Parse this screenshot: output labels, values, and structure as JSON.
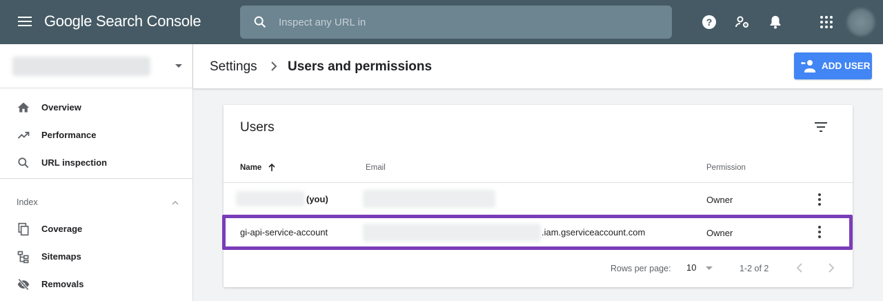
{
  "app": {
    "logo_text": "Google Search Console"
  },
  "search": {
    "placeholder": "Inspect any URL in"
  },
  "top_icons": [
    "help-icon",
    "manage-accounts-icon",
    "notifications-icon",
    "apps-grid-icon"
  ],
  "sidebar": {
    "items": [
      {
        "label": "Overview",
        "icon": "home-icon"
      },
      {
        "label": "Performance",
        "icon": "trending-up-icon"
      },
      {
        "label": "URL inspection",
        "icon": "search-icon"
      }
    ],
    "section": {
      "label": "Index"
    },
    "index_items": [
      {
        "label": "Coverage",
        "icon": "coverage-icon"
      },
      {
        "label": "Sitemaps",
        "icon": "sitemap-icon"
      },
      {
        "label": "Removals",
        "icon": "removals-icon"
      }
    ]
  },
  "header": {
    "crumb_parent": "Settings",
    "crumb_current": "Users and permissions",
    "add_user_label": "ADD USER"
  },
  "users_card": {
    "title": "Users",
    "columns": {
      "name": "Name",
      "email": "Email",
      "permission": "Permission"
    },
    "rows": [
      {
        "name_suffix": "(you)",
        "email_suffix": "",
        "permission": "Owner"
      },
      {
        "name": "gi-api-service-account",
        "email_suffix": ".iam.gserviceaccount.com",
        "permission": "Owner"
      }
    ],
    "footer": {
      "rows_per_page_label": "Rows per page:",
      "rows_per_page_value": "10",
      "range": "1-2 of 2"
    }
  },
  "colors": {
    "topbar": "#455a64",
    "accent": "#4285f4",
    "highlight": "#7a3db8"
  }
}
